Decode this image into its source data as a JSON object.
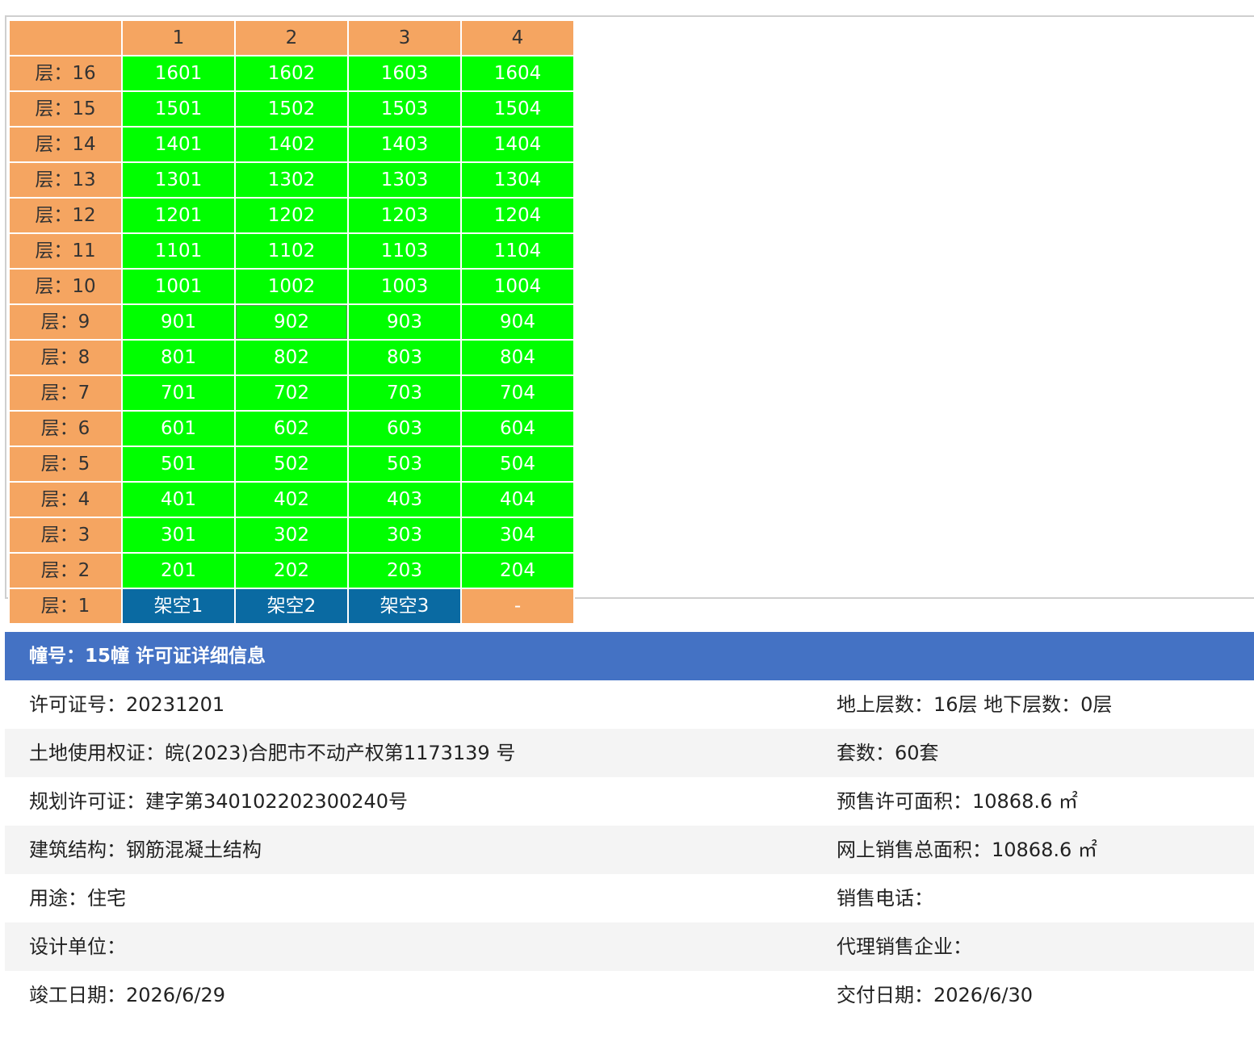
{
  "grid": {
    "column_headers": [
      "",
      "1",
      "2",
      "3",
      "4"
    ],
    "rows": [
      {
        "label": "层：16",
        "units": [
          "1601",
          "1602",
          "1603",
          "1604"
        ],
        "status": [
          "green",
          "green",
          "green",
          "green"
        ]
      },
      {
        "label": "层：15",
        "units": [
          "1501",
          "1502",
          "1503",
          "1504"
        ],
        "status": [
          "green",
          "green",
          "green",
          "green"
        ]
      },
      {
        "label": "层：14",
        "units": [
          "1401",
          "1402",
          "1403",
          "1404"
        ],
        "status": [
          "green",
          "green",
          "green",
          "green"
        ]
      },
      {
        "label": "层：13",
        "units": [
          "1301",
          "1302",
          "1303",
          "1304"
        ],
        "status": [
          "green",
          "green",
          "green",
          "green"
        ]
      },
      {
        "label": "层：12",
        "units": [
          "1201",
          "1202",
          "1203",
          "1204"
        ],
        "status": [
          "green",
          "green",
          "green",
          "green"
        ]
      },
      {
        "label": "层：11",
        "units": [
          "1101",
          "1102",
          "1103",
          "1104"
        ],
        "status": [
          "green",
          "green",
          "green",
          "green"
        ]
      },
      {
        "label": "层：10",
        "units": [
          "1001",
          "1002",
          "1003",
          "1004"
        ],
        "status": [
          "green",
          "green",
          "green",
          "green"
        ]
      },
      {
        "label": "层：9",
        "units": [
          "901",
          "902",
          "903",
          "904"
        ],
        "status": [
          "green",
          "green",
          "green",
          "green"
        ]
      },
      {
        "label": "层：8",
        "units": [
          "801",
          "802",
          "803",
          "804"
        ],
        "status": [
          "green",
          "green",
          "green",
          "green"
        ]
      },
      {
        "label": "层：7",
        "units": [
          "701",
          "702",
          "703",
          "704"
        ],
        "status": [
          "green",
          "green",
          "green",
          "green"
        ]
      },
      {
        "label": "层：6",
        "units": [
          "601",
          "602",
          "603",
          "604"
        ],
        "status": [
          "green",
          "green",
          "green",
          "green"
        ]
      },
      {
        "label": "层：5",
        "units": [
          "501",
          "502",
          "503",
          "504"
        ],
        "status": [
          "green",
          "green",
          "green",
          "green"
        ]
      },
      {
        "label": "层：4",
        "units": [
          "401",
          "402",
          "403",
          "404"
        ],
        "status": [
          "green",
          "green",
          "green",
          "green"
        ]
      },
      {
        "label": "层：3",
        "units": [
          "301",
          "302",
          "303",
          "304"
        ],
        "status": [
          "green",
          "green",
          "green",
          "green"
        ]
      },
      {
        "label": "层：2",
        "units": [
          "201",
          "202",
          "203",
          "204"
        ],
        "status": [
          "green",
          "green",
          "green",
          "green"
        ]
      },
      {
        "label": "层：1",
        "units": [
          "架空1",
          "架空2",
          "架空3",
          "-"
        ],
        "status": [
          "blue",
          "blue",
          "blue",
          "empty"
        ]
      }
    ],
    "focused_unit": "902",
    "colors": {
      "header_orange": "#f5a561",
      "unit_green": "#00ff00",
      "unit_blue": "#0a6aa2",
      "info_header_blue": "#4472c4"
    }
  },
  "info": {
    "title": "幢号：15幢 许可证详细信息",
    "rows": [
      [
        "许可证号：20231201",
        "地上层数：16层  地下层数：0层"
      ],
      [
        "土地使用权证：皖(2023)合肥市不动产权第1173139 号",
        "套数：60套"
      ],
      [
        "规划许可证：建字第340102202300240号",
        "预售许可面积：10868.6 ㎡"
      ],
      [
        "建筑结构：钢筋混凝土结构",
        "网上销售总面积：10868.6 ㎡"
      ],
      [
        "用途：住宅",
        "销售电话："
      ],
      [
        "设计单位：",
        "代理销售企业："
      ],
      [
        "竣工日期：2026/6/29",
        "交付日期：2026/6/30"
      ]
    ]
  }
}
